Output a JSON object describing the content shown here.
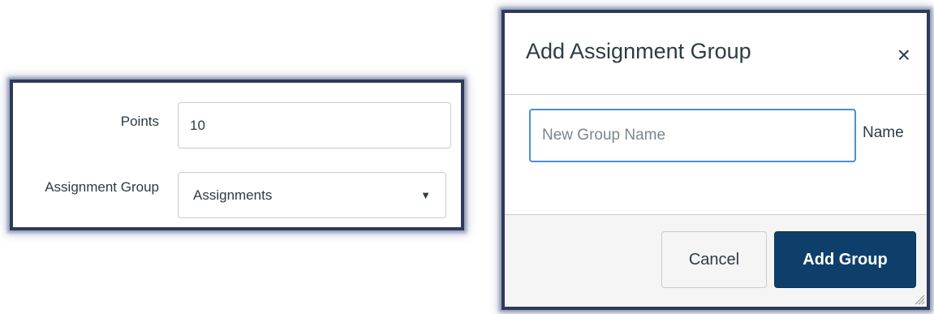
{
  "assignment_form": {
    "points_label": "Points",
    "points_value": "10",
    "group_label": "Assignment Group",
    "group_selected": "Assignments"
  },
  "dialog": {
    "title": "Add Assignment Group",
    "close_glyph": "×",
    "name_placeholder": "New Group Name",
    "name_value": "",
    "name_label": "Name",
    "cancel_label": "Cancel",
    "add_label": "Add Group"
  },
  "icons": {
    "select_arrow": "▼",
    "close": "×"
  },
  "colors": {
    "frame": "#2e3a5a",
    "primary_button": "#0e3f6b",
    "focus_border": "#4d8fd3",
    "text": "#2d3b45"
  }
}
